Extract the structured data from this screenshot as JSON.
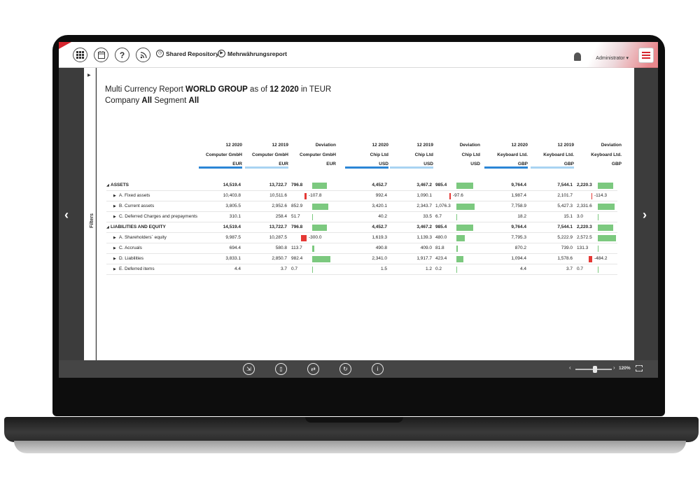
{
  "topbar": {
    "breadcrumb_repo": "Shared Repository",
    "breadcrumb_report": "Mehrwährungsreport",
    "user": "Administrator"
  },
  "filters": {
    "label": "Filters"
  },
  "report": {
    "title_part1": "Multi Currency Report ",
    "title_group": "WORLD GROUP",
    "title_part2": " as of ",
    "title_period": "12 2020",
    "title_part3": " in TEUR",
    "subtitle_part1": "Company ",
    "subtitle_company": "All",
    "subtitle_part2": " Segment ",
    "subtitle_segment": "All"
  },
  "columns": [
    {
      "period": "12 2020",
      "entity": "Computer GmbH",
      "currency": "EUR"
    },
    {
      "period": "12 2019",
      "entity": "Computer GmbH",
      "currency": "EUR"
    },
    {
      "period": "Deviation",
      "entity": "Computer GmbH",
      "currency": "EUR"
    },
    {
      "period": "12 2020",
      "entity": "Chip Ltd",
      "currency": "USD"
    },
    {
      "period": "12 2019",
      "entity": "Chip Ltd",
      "currency": "USD"
    },
    {
      "period": "Deviation",
      "entity": "Chip Ltd",
      "currency": "USD"
    },
    {
      "period": "12 2020",
      "entity": "Keyboard Ltd.",
      "currency": "GBP"
    },
    {
      "period": "12 2019",
      "entity": "Keyboard Ltd.",
      "currency": "GBP"
    },
    {
      "period": "Deviation",
      "entity": "Keyboard Ltd.",
      "currency": "GBP"
    }
  ],
  "rows": [
    {
      "label": "ASSETS",
      "bold": true,
      "indent": 0,
      "values": [
        "14,519.4",
        "13,722.7",
        "796.8",
        "4,452.7",
        "3,467.2",
        "985.4",
        "9,764.4",
        "7,544.1",
        "2,220.3"
      ],
      "deviation_numbers": [
        796.8,
        985.4,
        2220.3
      ]
    },
    {
      "label": "A. Fixed assets",
      "bold": false,
      "indent": 1,
      "values": [
        "10,403.8",
        "10,511.6",
        "-107.8",
        "992.4",
        "1,090.1",
        "-97.6",
        "1,987.4",
        "2,101.7",
        "-114.3"
      ],
      "deviation_numbers": [
        -107.8,
        -97.6,
        -114.3
      ]
    },
    {
      "label": "B. Current assets",
      "bold": false,
      "indent": 1,
      "values": [
        "3,805.5",
        "2,952.6",
        "852.9",
        "3,420.1",
        "2,343.7",
        "1,076.3",
        "7,758.9",
        "5,427.3",
        "2,331.6"
      ],
      "deviation_numbers": [
        852.9,
        1076.3,
        2331.6
      ]
    },
    {
      "label": "C. Deferred Charges and prepayments",
      "bold": false,
      "indent": 1,
      "values": [
        "310.1",
        "258.4",
        "51.7",
        "40.2",
        "33.5",
        "6.7",
        "18.2",
        "15.1",
        "3.0"
      ],
      "deviation_numbers": [
        51.7,
        6.7,
        3.0
      ]
    },
    {
      "label": "LIABILITIES AND EQUITY",
      "bold": true,
      "indent": 0,
      "values": [
        "14,519.4",
        "13,722.7",
        "796.8",
        "4,452.7",
        "3,467.2",
        "985.4",
        "9,764.4",
        "7,544.1",
        "2,220.3"
      ],
      "deviation_numbers": [
        796.8,
        985.4,
        2220.3
      ]
    },
    {
      "label": "A. Shareholders´ equity",
      "bold": false,
      "indent": 1,
      "values": [
        "9,987.5",
        "10,287.5",
        "-300.0",
        "1,619.3",
        "1,139.3",
        "480.0",
        "7,795.3",
        "5,222.9",
        "2,572.5"
      ],
      "deviation_numbers": [
        -300.0,
        480.0,
        2572.5
      ]
    },
    {
      "label": "C. Accruals",
      "bold": false,
      "indent": 1,
      "values": [
        "694.4",
        "580.8",
        "113.7",
        "490.8",
        "409.0",
        "81.8",
        "870.2",
        "739.0",
        "131.3"
      ],
      "deviation_numbers": [
        113.7,
        81.8,
        131.3
      ]
    },
    {
      "label": "D. Liabilities",
      "bold": false,
      "indent": 1,
      "values": [
        "3,833.1",
        "2,850.7",
        "982.4",
        "2,341.0",
        "1,917.7",
        "423.4",
        "1,094.4",
        "1,578.6",
        "-484.2"
      ],
      "deviation_numbers": [
        982.4,
        423.4,
        -484.2
      ]
    },
    {
      "label": "E. Deferred items",
      "bold": false,
      "indent": 1,
      "values": [
        "4.4",
        "3.7",
        "0.7",
        "1.5",
        "1.2",
        "0.2",
        "4.4",
        "3.7",
        "0.7"
      ],
      "deviation_numbers": [
        0.7,
        0.2,
        0.7
      ]
    }
  ],
  "toolbar": {
    "zoom_level": "120%"
  },
  "colors": {
    "accent": "#2b86d6",
    "accent_light": "#a9d3f2",
    "positive": "#7cc97f",
    "negative": "#e53935",
    "brand": "#d6262f"
  }
}
